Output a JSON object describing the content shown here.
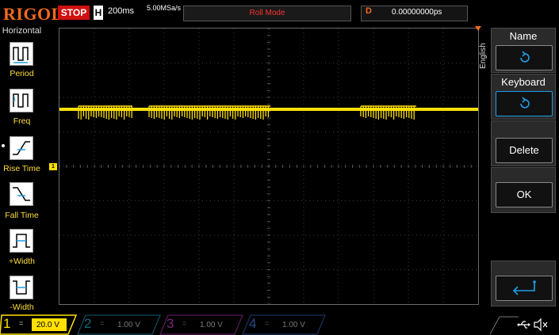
{
  "header": {
    "brand": "RIGOL",
    "run_state": "STOP",
    "timebase_label": "H",
    "timebase_value": "200ms",
    "sample_rate": "5.00MSa/s",
    "mode_text": "Roll Mode",
    "delay_label": "D",
    "delay_value": "0.00000000ps"
  },
  "left_menu": {
    "title": "Horizontal",
    "items": [
      {
        "label": "Period",
        "icon": "period-icon"
      },
      {
        "label": "Freq",
        "icon": "frequency-icon"
      },
      {
        "label": "Rise Time",
        "icon": "rise-time-icon"
      },
      {
        "label": "Fall Time",
        "icon": "fall-time-icon"
      },
      {
        "label": "+Width",
        "icon": "positive-width-icon"
      },
      {
        "label": "-Width",
        "icon": "negative-width-icon"
      }
    ]
  },
  "right_menu": {
    "language": "English",
    "name_label": "Name",
    "keyboard_label": "Keyboard",
    "delete_label": "Delete",
    "ok_label": "OK",
    "enter_icon": "enter-return-icon"
  },
  "channels": [
    {
      "num": "1",
      "coupling": "=",
      "scale": "20.0 V",
      "color": "#ffe000",
      "active": true
    },
    {
      "num": "2",
      "coupling": "=",
      "scale": "1.00 V",
      "color": "#15a8d8",
      "active": false
    },
    {
      "num": "3",
      "coupling": "=",
      "scale": "1.00 V",
      "color": "#d020d0",
      "active": false
    },
    {
      "num": "4",
      "coupling": "=",
      "scale": "1.00 V",
      "color": "#2060e0",
      "active": false
    }
  ],
  "screen": {
    "ch1_marker": "1",
    "trace_color": "#ffe000",
    "grid_color": "#3a3a3a"
  },
  "status_icons": [
    "usb-icon",
    "speaker-mute-icon"
  ]
}
